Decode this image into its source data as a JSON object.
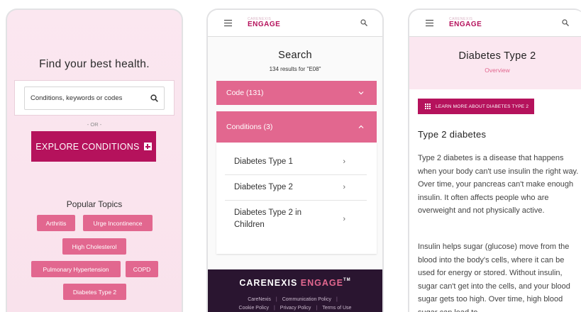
{
  "screen1": {
    "title": "Find your best health.",
    "search_placeholder": "Conditions, keywords or codes",
    "or_label": "- OR -",
    "explore_label": "EXPLORE CONDITIONS",
    "popular_title": "Popular Topics",
    "topics": [
      "Arthritis",
      "Urge Incontinence",
      "High Cholesterol",
      "Pulmonary Hypertension",
      "COPD",
      "Diabetes Type 2"
    ]
  },
  "brand": {
    "top": "CARENEXIS",
    "bottom": "ENGAGE"
  },
  "screen2": {
    "title": "Search",
    "results": "134 results for \"E08\"",
    "code_section": "Code (131)",
    "conditions_section": "Conditions (3)",
    "conditions": [
      "Diabetes Type 1",
      "Diabetes Type 2",
      "Diabetes Type 2 in Children"
    ],
    "footer": {
      "brand_a": "CARENEXIS",
      "brand_b": "ENGAGE",
      "tm": "TM",
      "links_row1": [
        "CareNexis",
        "Communication Policy"
      ],
      "links_row2": [
        "Cookie Policy",
        "Privacy Policy",
        "Terms of Use"
      ]
    }
  },
  "screen3": {
    "title": "Diabetes Type 2",
    "subtitle": "Overview",
    "learn_label": "LEARN MORE ABOUT DIABETES TYPE 2",
    "heading": "Type 2 diabetes",
    "para1": "Type 2 diabetes is a disease that happens when your body can't use insulin the right way. Over time, your pancreas can't make enough insulin. It often affects people who are overweight and not physically active.",
    "para2": "Insulin helps sugar (glucose) move from the blood into the body's cells, where it can be used for energy or stored. Without insulin, sugar can't get into the cells, and your blood sugar gets too high. Over time, high blood sugar can lead to"
  },
  "colors": {
    "brand_dark": "#b5125c",
    "brand_pink": "#e2678f",
    "hero_bg": "#fbe7f0",
    "footer_bg": "#2a1530"
  },
  "icons": [
    "search-icon",
    "plus-box-icon",
    "menu-icon",
    "chevron-down-icon",
    "chevron-up-icon",
    "chevron-right-icon",
    "grid-icon"
  ]
}
